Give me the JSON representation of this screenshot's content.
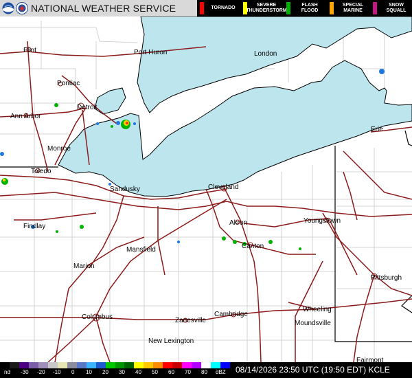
{
  "header": {
    "org_name": "NATIONAL WEATHER SERVICE",
    "logos": [
      "noaa-logo",
      "nws-logo"
    ]
  },
  "legend": [
    {
      "label": "TORNADO",
      "color": "#ff0000"
    },
    {
      "label": "SEVERE\nTHUNDERSTORM",
      "color": "#ffff00"
    },
    {
      "label": "FLASH\nFLOOD",
      "color": "#00b000"
    },
    {
      "label": "SPECIAL\nMARINE",
      "color": "#ffa500"
    },
    {
      "label": "SNOW\nSQUALL",
      "color": "#c71585"
    }
  ],
  "map": {
    "colors": {
      "lake": "#bde5ee",
      "road": "#8b1a1a",
      "boundary": "#000000",
      "county": "#c8c8c8"
    },
    "cities": [
      {
        "name": "Flint",
        "id": "flint"
      },
      {
        "name": "Port Huron",
        "id": "port-huron"
      },
      {
        "name": "London",
        "id": "london"
      },
      {
        "name": "Pontiac",
        "id": "pontiac"
      },
      {
        "name": "Detroit",
        "id": "detroit"
      },
      {
        "name": "Ann Arbor",
        "id": "ann-arbor"
      },
      {
        "name": "Monroe",
        "id": "monroe"
      },
      {
        "name": "Toledo",
        "id": "toledo"
      },
      {
        "name": "Sandusky",
        "id": "sandusky"
      },
      {
        "name": "Cleveland",
        "id": "cleveland"
      },
      {
        "name": "Erie",
        "id": "erie"
      },
      {
        "name": "Findlay",
        "id": "findlay"
      },
      {
        "name": "Akron",
        "id": "akron"
      },
      {
        "name": "Youngstown",
        "id": "youngstown"
      },
      {
        "name": "Mansfield",
        "id": "mansfield"
      },
      {
        "name": "Canton",
        "id": "canton"
      },
      {
        "name": "Marion",
        "id": "marion"
      },
      {
        "name": "Pittsburgh",
        "id": "pittsburgh"
      },
      {
        "name": "Wheeling",
        "id": "wheeling"
      },
      {
        "name": "Columbus",
        "id": "columbus"
      },
      {
        "name": "Zanesville",
        "id": "zanesville"
      },
      {
        "name": "Cambridge",
        "id": "cambridge"
      },
      {
        "name": "Moundsville",
        "id": "moundsville"
      },
      {
        "name": "New Lexington",
        "id": "new-lexington"
      },
      {
        "name": "Fairmont",
        "id": "fairmont"
      }
    ]
  },
  "colorbar": {
    "labels": [
      "nd",
      "-30",
      "-20",
      "-10",
      "0",
      "10",
      "20",
      "30",
      "40",
      "50",
      "60",
      "70",
      "80",
      "dBZ"
    ],
    "colors": [
      "#000000",
      "#1a1a1a",
      "#4b0082",
      "#7a5ca8",
      "#9e90b8",
      "#c8c8c8",
      "#e6e6b4",
      "#8c8ca0",
      "#5a78c8",
      "#3cb4ff",
      "#1e5ad2",
      "#00c800",
      "#009600",
      "#006400",
      "#ffff00",
      "#ffc800",
      "#ff8c00",
      "#ff0000",
      "#c80000",
      "#ff00ff",
      "#b400ff",
      "#ffffff",
      "#00ffff",
      "#0000ff"
    ]
  },
  "timestamp": "08/14/2026 23:50 UTC (19:50 EDT)  KCLE"
}
